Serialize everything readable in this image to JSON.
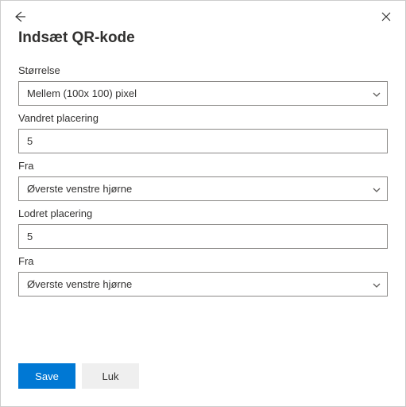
{
  "title": "Indsæt QR-kode",
  "fields": {
    "size": {
      "label": "Størrelse",
      "value": "Mellem (100x 100) pixel"
    },
    "hpos": {
      "label": "Vandret placering",
      "value": "5"
    },
    "hfrom": {
      "label": "Fra",
      "value": "Øverste venstre hjørne"
    },
    "vpos": {
      "label": "Lodret placering",
      "value": "5"
    },
    "vfrom": {
      "label": "Fra",
      "value": "Øverste venstre hjørne"
    }
  },
  "buttons": {
    "save": "Save",
    "close": "Luk"
  }
}
